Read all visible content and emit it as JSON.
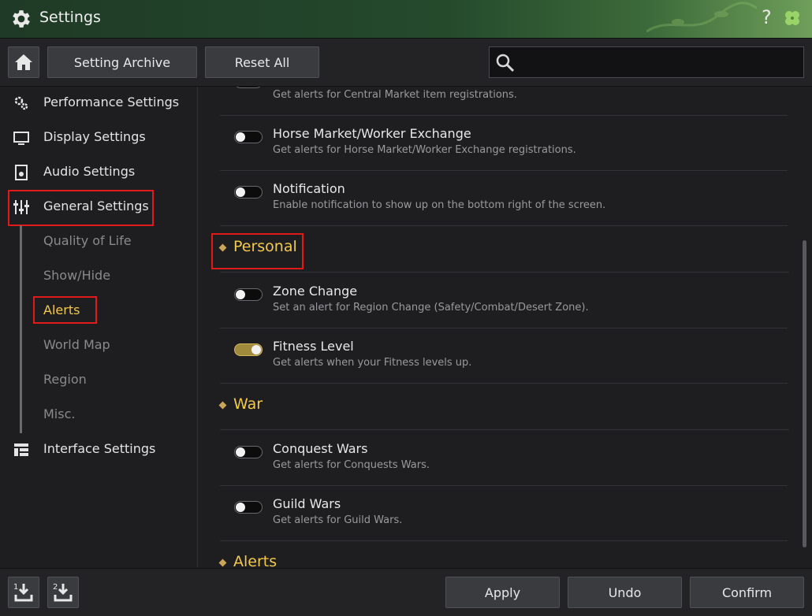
{
  "window": {
    "title": "Settings",
    "help_label": "?"
  },
  "toolbar": {
    "archive_label": "Setting Archive",
    "reset_label": "Reset All",
    "search_value": ""
  },
  "sidebar": {
    "items": [
      {
        "label": "Performance Settings",
        "icon": "gears-icon"
      },
      {
        "label": "Display Settings",
        "icon": "monitor-icon"
      },
      {
        "label": "Audio Settings",
        "icon": "speaker-icon"
      },
      {
        "label": "General Settings",
        "icon": "sliders-icon"
      },
      {
        "label": "Interface Settings",
        "icon": "layout-icon"
      }
    ],
    "subitems": [
      "Quality of Life",
      "Show/Hide",
      "Alerts",
      "World Map",
      "Region",
      "Misc."
    ],
    "active_subitem": "Alerts"
  },
  "content": {
    "rows": [
      {
        "title": "",
        "desc": "Get alerts for Central Market item registrations.",
        "on": false
      },
      {
        "title": "Horse Market/Worker Exchange",
        "desc": "Get alerts for Horse Market/Worker Exchange registrations.",
        "on": false
      },
      {
        "title": "Notification",
        "desc": "Enable notification to show up on the bottom right of the screen.",
        "on": false
      },
      {
        "title": "Zone Change",
        "desc": "Set an alert for Region Change (Safety/Combat/Desert Zone).",
        "on": false
      },
      {
        "title": "Fitness Level",
        "desc": "Get alerts when your Fitness levels up.",
        "on": true
      },
      {
        "title": "Conquest Wars",
        "desc": "Get alerts for Conquests Wars.",
        "on": false
      },
      {
        "title": "Guild Wars",
        "desc": "Get alerts for Guild Wars.",
        "on": false
      }
    ],
    "sections": [
      "Personal",
      "War",
      "Alerts"
    ]
  },
  "footer": {
    "preset1": "1",
    "preset2": "2",
    "apply_label": "Apply",
    "undo_label": "Undo",
    "confirm_label": "Confirm"
  },
  "colors": {
    "accent": "#f2c94c",
    "highlight": "#e01919",
    "toggle_on": "#a08a3c"
  }
}
